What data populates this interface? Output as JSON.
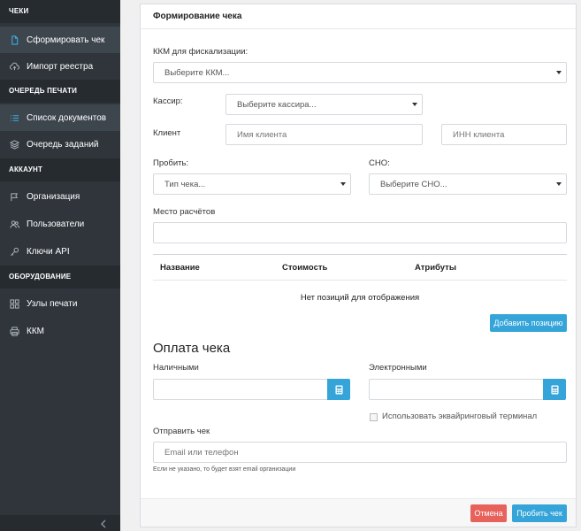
{
  "sidebar": {
    "sections": [
      {
        "title": "ЧЕКИ"
      },
      {
        "title": "ОЧЕРЕДЬ ПЕЧАТИ"
      },
      {
        "title": "АККАУНТ"
      },
      {
        "title": "ОБОРУДОВАНИЕ"
      }
    ],
    "items": [
      {
        "label": "Сформировать чек",
        "icon": "document-icon"
      },
      {
        "label": "Импорт реестра",
        "icon": "cloud-upload-icon"
      },
      {
        "label": "Список документов",
        "icon": "list-icon"
      },
      {
        "label": "Очередь заданий",
        "icon": "layers-icon"
      },
      {
        "label": "Организация",
        "icon": "flag-icon"
      },
      {
        "label": "Пользователи",
        "icon": "users-icon"
      },
      {
        "label": "Ключи API",
        "icon": "key-icon"
      },
      {
        "label": "Узлы печати",
        "icon": "grid-icon"
      },
      {
        "label": "ККМ",
        "icon": "printer-icon"
      }
    ]
  },
  "form": {
    "title": "Формирование чека",
    "kkm_label": "ККМ для фискализации:",
    "kkm_value": "Выберите ККМ...",
    "cashier_label": "Кассир:",
    "cashier_value": "Выберите кассира...",
    "client_label": "Клиент",
    "client_name_placeholder": "Имя клиента",
    "client_inn_placeholder": "ИНН клиента",
    "punch_label": "Пробить:",
    "punch_value": "Тип чека...",
    "sno_label": "СНО:",
    "sno_value": "Выберите СНО...",
    "place_label": "Место расчётов",
    "place_value": ""
  },
  "table": {
    "columns": [
      "Название",
      "Стоимость",
      "Атрибуты"
    ],
    "empty_text": "Нет позиций для отображения",
    "add_button": "Добавить позицию"
  },
  "payment": {
    "title": "Оплата чека",
    "cash_label": "Наличными",
    "cash_value": "",
    "electronic_label": "Электронными",
    "electronic_value": "",
    "acquiring_label": "Использовать эквайринговый терминал",
    "acquiring_checked": false,
    "send_label": "Отправить чек",
    "send_placeholder": "Email или телефон",
    "send_hint": "Если не указано, то будет взят email организации"
  },
  "footer": {
    "cancel": "Отмена",
    "submit": "Пробить чек"
  },
  "colors": {
    "accent": "#34a4d9",
    "danger": "#e8625c",
    "sidebar": "#2f353b"
  }
}
